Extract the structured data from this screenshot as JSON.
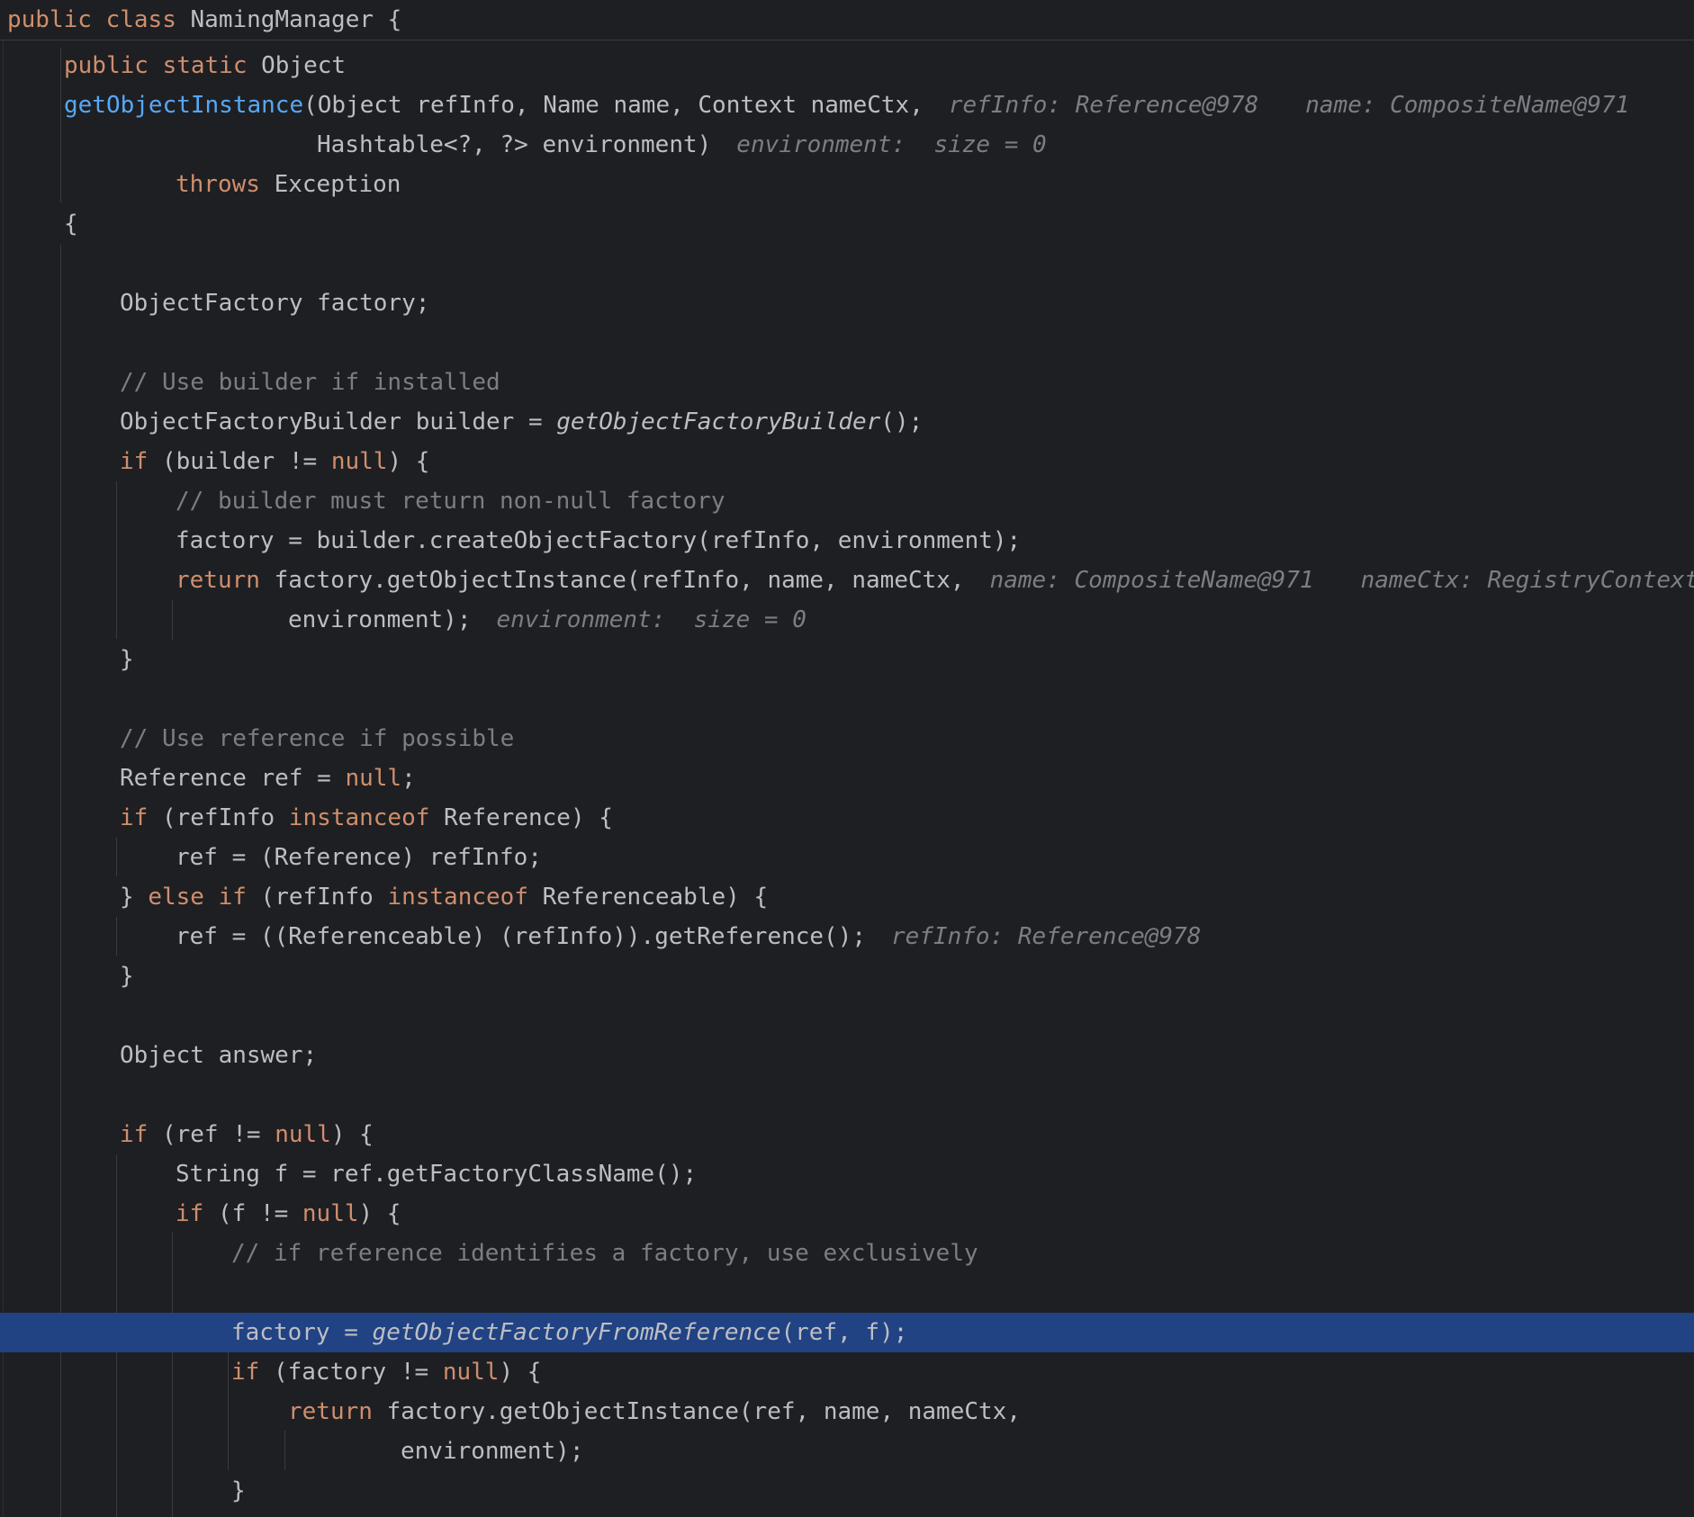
{
  "class_header": {
    "kw_public": "public",
    "kw_class": "class",
    "class_name": "NamingManager",
    "brace": " {"
  },
  "lines": {
    "l1": {
      "kw": "public static",
      "rest": " Object"
    },
    "l2": {
      "fn": "getObjectInstance",
      "rest": "(Object refInfo, Name name, Context nameCtx,",
      "hint1": "refInfo: Reference@978",
      "hint2": "name: CompositeName@971"
    },
    "l3": {
      "rest": "Hashtable<?, ?> environment)",
      "hint1": "environment:  size = 0"
    },
    "l4": {
      "kw": "throws",
      "rest": " Exception"
    },
    "l5": {
      "rest": "{"
    },
    "l6": {
      "rest": "ObjectFactory factory;"
    },
    "l7": {
      "cm": "// Use builder if installed"
    },
    "l8": {
      "pre": "ObjectFactoryBuilder builder = ",
      "it": "getObjectFactoryBuilder",
      "post": "();"
    },
    "l9": {
      "kw": "if",
      "mid": " (builder != ",
      "kw2": "null",
      "post": ") {"
    },
    "l10": {
      "cm": "// builder must return non-null factory"
    },
    "l11": {
      "rest": "factory = builder.createObjectFactory(refInfo, environment);"
    },
    "l12": {
      "kw": "return",
      "rest": " factory.getObjectInstance(refInfo, name, nameCtx,",
      "hint1": "name: CompositeName@971",
      "hint2": "nameCtx: RegistryContext@"
    },
    "l13": {
      "rest": "environment);",
      "hint1": "environment:  size = 0"
    },
    "l14": {
      "rest": "}"
    },
    "l15": {
      "cm": "// Use reference if possible"
    },
    "l16": {
      "pre": "Reference ref = ",
      "kw": "null",
      "post": ";"
    },
    "l17": {
      "kw": "if",
      "mid": " (refInfo ",
      "kw2": "instanceof",
      "post": " Reference) {"
    },
    "l18": {
      "rest": "ref = (Reference) refInfo;"
    },
    "l19": {
      "pre": "} ",
      "kw": "else if",
      "mid": " (refInfo ",
      "kw2": "instanceof",
      "post": " Referenceable) {"
    },
    "l20": {
      "rest": "ref = ((Referenceable) (refInfo)).getReference();",
      "hint1": "refInfo: Reference@978"
    },
    "l21": {
      "rest": "}"
    },
    "l22": {
      "rest": "Object answer;"
    },
    "l23": {
      "kw": "if",
      "mid": " (ref != ",
      "kw2": "null",
      "post": ") {"
    },
    "l24": {
      "rest": "String f = ref.getFactoryClassName();"
    },
    "l25": {
      "kw": "if",
      "mid": " (f != ",
      "kw2": "null",
      "post": ") {"
    },
    "l26": {
      "cm": "// if reference identifies a factory, use exclusively"
    },
    "l27": {
      "pre": "factory = ",
      "it": "getObjectFactoryFromReference",
      "post": "(ref, f);"
    },
    "l28": {
      "kw": "if",
      "mid": " (factory != ",
      "kw2": "null",
      "post": ") {"
    },
    "l29": {
      "kw": "return",
      "rest": " factory.getObjectInstance(ref, name, nameCtx,"
    },
    "l30": {
      "rest": "environment);"
    },
    "l31": {
      "rest": "}"
    }
  },
  "colors": {
    "background": "#1e1f22",
    "keyword": "#cf8e6d",
    "method_declaration": "#56a8f5",
    "text": "#bcbec4",
    "comment": "#7a7e85",
    "current_line": "#214283"
  }
}
